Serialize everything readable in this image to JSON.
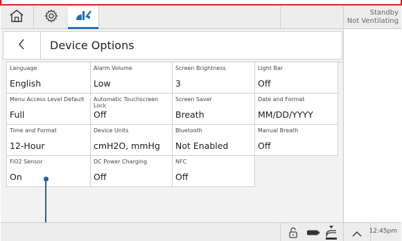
{
  "status": {
    "line1": "Standby",
    "line2": "Not Ventilating"
  },
  "header": {
    "title": "Device Options"
  },
  "options": [
    {
      "label": "Language",
      "value": "English"
    },
    {
      "label": "Alarm Volume",
      "value": "Low"
    },
    {
      "label": "Screen Brightness",
      "value": "3"
    },
    {
      "label": "Light Bar",
      "value": "Off"
    },
    {
      "label": "Menu Access Level Default",
      "value": "Full"
    },
    {
      "label": "Automatic Touchscreen Lock",
      "value": "Off"
    },
    {
      "label": "Screen Saver",
      "value": "Breath"
    },
    {
      "label": "Date and Format",
      "value": "MM/DD/YYYY"
    },
    {
      "label": "Time and Format",
      "value": "12-Hour"
    },
    {
      "label": "Device Units",
      "value": "cmH2O, mmHg"
    },
    {
      "label": "Bluetooth",
      "value": "Not Enabled"
    },
    {
      "label": "Manual Breath",
      "value": "Off"
    },
    {
      "label": "FiO2 Sensor",
      "value": "On"
    },
    {
      "label": "DC Power Charging",
      "value": "Off"
    },
    {
      "label": "NFC",
      "value": "Off"
    }
  ],
  "footer": {
    "time": "12:45pm"
  },
  "colors": {
    "accent": "#1f6fb5",
    "alarm_border": "#d81818",
    "callout": "#1f5fa8"
  },
  "icons": [
    "home-icon",
    "gear-icon",
    "device-options-icon",
    "back-chevron-icon",
    "unlock-icon",
    "battery-icon",
    "ac-power-icon",
    "chevron-up-icon"
  ]
}
